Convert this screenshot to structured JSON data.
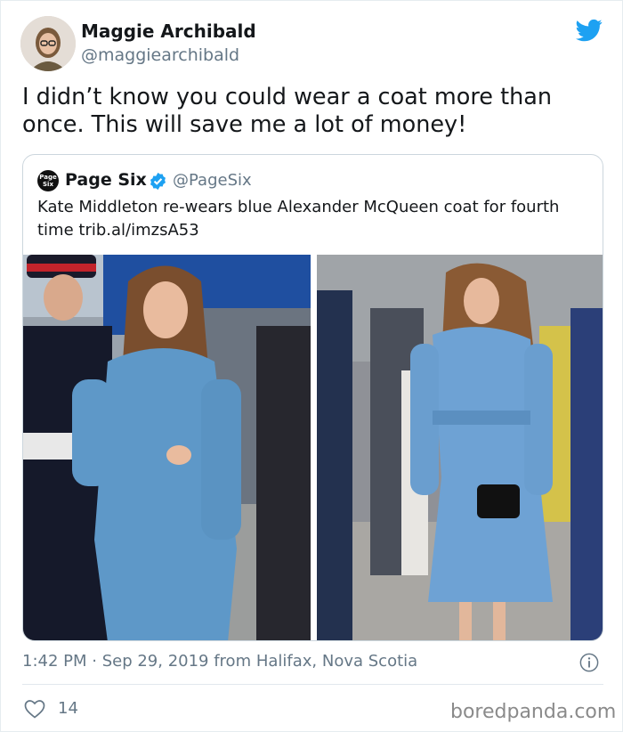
{
  "tweet": {
    "author_name": "Maggie Archibald",
    "author_handle": "@maggiearchibald",
    "text": "I didn’t know you could wear a coat more than once. This will save me a lot of money!",
    "timestamp": "1:42 PM · Sep 29, 2019 from Halifax, Nova Scotia",
    "like_count": "14"
  },
  "quoted_tweet": {
    "author_name": "Page Six",
    "author_handle": "@PageSix",
    "logo_text": "Page Six",
    "verified": true,
    "text": "Kate Middleton re-wears blue Alexander McQueen coat for fourth time trib.al/imzsA53"
  },
  "icons": {
    "brand": "twitter-bird-icon",
    "verified": "verified-badge-icon",
    "info": "info-icon",
    "like": "heart-icon"
  },
  "colors": {
    "twitter_blue": "#1da1f2",
    "secondary_text": "#657786",
    "coat_blue": "#5e98c8"
  },
  "watermark": "boredpanda.com"
}
